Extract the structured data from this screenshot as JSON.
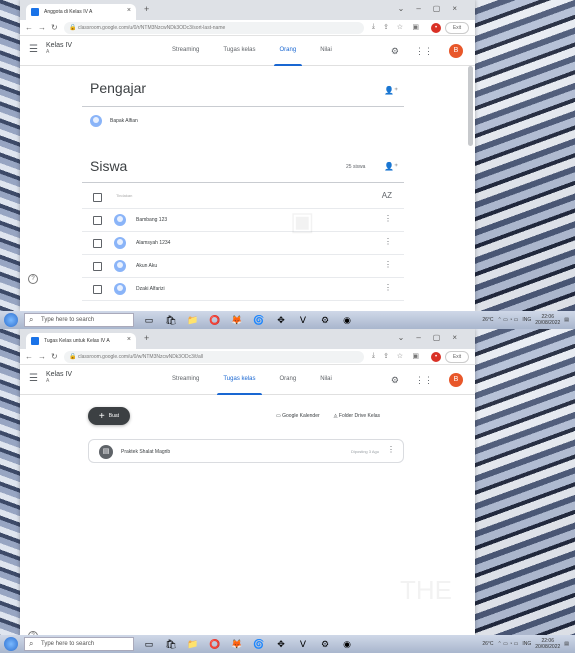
{
  "shot1": {
    "tab_title": "Anggota di Kelas IV A",
    "url": "classroom.google.com/u/0/r/NTM3NzcwNDk3ODc3/sort-last-name",
    "exit_label": "Exit",
    "class_name": "Kelas IV",
    "class_section": "A",
    "nav_tabs": [
      "Streaming",
      "Tugas kelas",
      "Orang",
      "Nilai"
    ],
    "active_tab": "Orang",
    "avatar_letter": "B",
    "teachers_title": "Pengajar",
    "teacher_name": "Bapak Alfian",
    "students_title": "Siswa",
    "students_count": "25 siswa",
    "select_action": "Tindakan",
    "students": [
      "Bambang 123",
      "Alamsyah 1234",
      "Akun Aku",
      "Dzaki Alfarizi"
    ]
  },
  "shot2": {
    "tab_title": "Tugas Kelas untuk Kelas IV A",
    "url": "classroom.google.com/u/0/w/NTM3NzcwNDk3ODc3/t/all",
    "exit_label": "Exit",
    "class_name": "Kelas IV",
    "class_section": "A",
    "nav_tabs": [
      "Streaming",
      "Tugas kelas",
      "Orang",
      "Nilai"
    ],
    "active_tab": "Tugas kelas",
    "avatar_letter": "B",
    "create_label": "Buat",
    "calendar_label": "Google Kalender",
    "drive_label": "Folder Drive Kelas",
    "assignment_title": "Praktek Shalat Magrib",
    "assignment_date": "Diposting 3 Agu"
  },
  "taskbar": {
    "search_placeholder": "Type here to search",
    "weather": "26°C",
    "lang": "ING",
    "time1": "22:06",
    "date1": "20/08/2022",
    "time2": "22:06",
    "date2": "20/08/2022"
  },
  "colors": {
    "accent": "#1967d2",
    "avatar": "#e8572a",
    "fab": "#3c4043"
  }
}
